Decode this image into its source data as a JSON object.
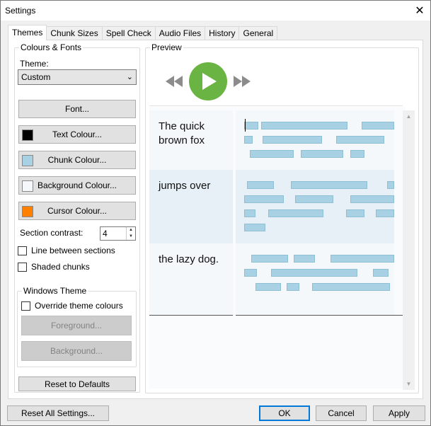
{
  "window": {
    "title": "Settings",
    "close_glyph": "✕"
  },
  "tabs": [
    {
      "label": "Themes",
      "active": true
    },
    {
      "label": "Chunk Sizes"
    },
    {
      "label": "Spell Check"
    },
    {
      "label": "Audio Files"
    },
    {
      "label": "History"
    },
    {
      "label": "General"
    }
  ],
  "colours_fonts": {
    "legend": "Colours & Fonts",
    "theme_label": "Theme:",
    "theme_value": "Custom",
    "font_button": "Font...",
    "text_colour_button": "Text Colour...",
    "chunk_colour_button": "Chunk Colour...",
    "background_colour_button": "Background Colour...",
    "cursor_colour_button": "Cursor Colour...",
    "text_colour": "#000000",
    "chunk_colour": "#a8d2e3",
    "background_colour": "#f4f8fb",
    "cursor_colour": "#ff8000",
    "section_contrast_label": "Section contrast:",
    "section_contrast_value": "4",
    "line_between_sections": "Line between sections",
    "shaded_chunks": "Shaded chunks"
  },
  "windows_theme": {
    "legend": "Windows Theme",
    "override_label": "Override theme colours",
    "foreground_button": "Foreground...",
    "background_button": "Background..."
  },
  "reset_defaults_button": "Reset to Defaults",
  "preview": {
    "legend": "Preview",
    "play_color": "#6ab443",
    "rows": [
      {
        "text_lines": [
          "The quick",
          "brown fox"
        ],
        "shaded": false
      },
      {
        "text_lines": [
          "jumps over"
        ],
        "shaded": true
      },
      {
        "text_lines": [
          "the lazy dog."
        ],
        "shaded": false
      }
    ]
  },
  "footer": {
    "reset_all": "Reset All Settings...",
    "ok": "OK",
    "cancel": "Cancel",
    "apply": "Apply"
  }
}
